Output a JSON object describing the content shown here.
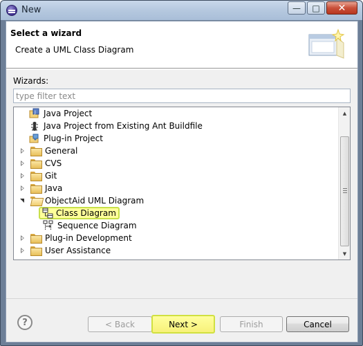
{
  "window": {
    "title": "New",
    "buttons": {
      "minimize": "—",
      "maximize": "□",
      "close": "✕"
    }
  },
  "header": {
    "title": "Select a wizard",
    "subtitle": "Create a UML Class Diagram"
  },
  "wizards_label": "Wizards:",
  "filter": {
    "placeholder": "type filter text",
    "value": ""
  },
  "tree": {
    "items": [
      {
        "label": "Java Project",
        "icon": "java-project-icon",
        "level": 1,
        "expander": "none"
      },
      {
        "label": "Java Project from Existing Ant Buildfile",
        "icon": "ant-icon",
        "level": 1,
        "expander": "none"
      },
      {
        "label": "Plug-in Project",
        "icon": "plugin-project-icon",
        "level": 1,
        "expander": "none"
      },
      {
        "label": "General",
        "icon": "folder-icon",
        "level": 0,
        "expander": "collapsed"
      },
      {
        "label": "CVS",
        "icon": "folder-icon",
        "level": 0,
        "expander": "collapsed"
      },
      {
        "label": "Git",
        "icon": "folder-icon",
        "level": 0,
        "expander": "collapsed"
      },
      {
        "label": "Java",
        "icon": "folder-icon",
        "level": 0,
        "expander": "collapsed"
      },
      {
        "label": "ObjectAid UML Diagram",
        "icon": "folder-open-icon",
        "level": 0,
        "expander": "expanded"
      },
      {
        "label": "Class Diagram",
        "icon": "class-diagram-icon",
        "level": 2,
        "expander": "none",
        "selected": true
      },
      {
        "label": "Sequence Diagram",
        "icon": "sequence-diagram-icon",
        "level": 2,
        "expander": "none"
      },
      {
        "label": "Plug-in Development",
        "icon": "folder-icon",
        "level": 0,
        "expander": "collapsed"
      },
      {
        "label": "User Assistance",
        "icon": "folder-icon",
        "level": 0,
        "expander": "collapsed"
      }
    ]
  },
  "buttons": {
    "help": "?",
    "back": "< Back",
    "next": "Next >",
    "finish": "Finish",
    "cancel": "Cancel"
  },
  "colors": {
    "highlight": "#ffff9a",
    "highlight_border": "#c8e04a"
  }
}
